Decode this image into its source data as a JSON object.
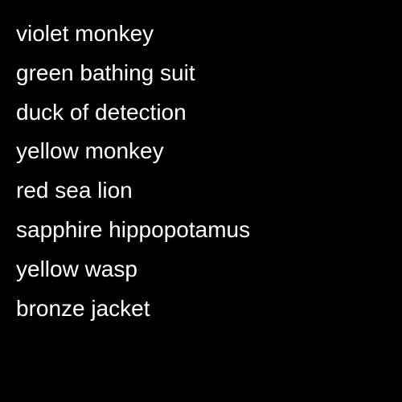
{
  "colors": {
    "background": "#000000",
    "text": "#ffffff"
  },
  "items": [
    "violet monkey",
    "green bathing suit",
    "duck of detection",
    "yellow monkey",
    "red sea lion",
    "sapphire hippopotamus",
    "yellow wasp",
    "bronze jacket"
  ]
}
